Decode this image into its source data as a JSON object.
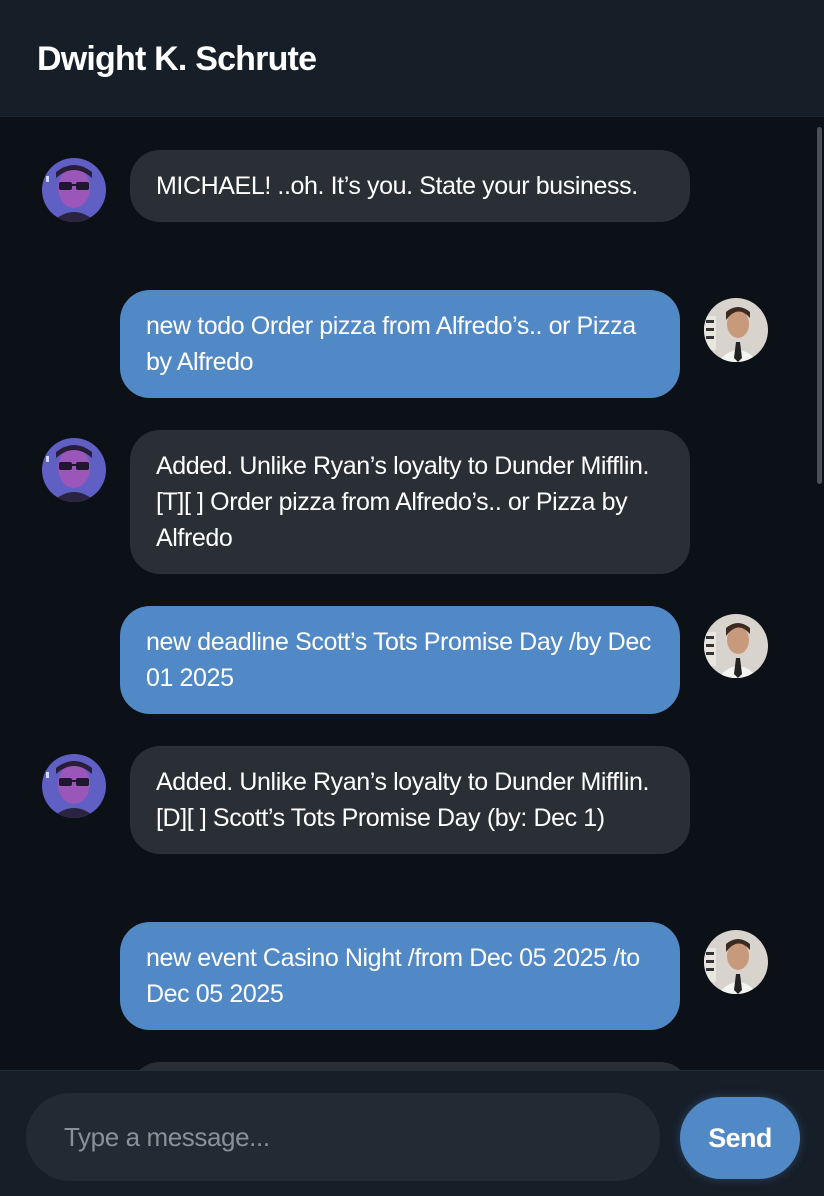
{
  "header": {
    "title": "Dwight K. Schrute"
  },
  "messages": [
    {
      "sender": "bot",
      "text": "MICHAEL! ..oh. It’s you. State your business."
    },
    {
      "sender": "user",
      "text": "new todo Order pizza from Alfredo’s.. or Pizza by Alfredo"
    },
    {
      "sender": "bot",
      "text": "Added. Unlike Ryan’s loyalty to Dunder Mifflin. [T][ ] Order pizza from Alfredo’s.. or Pizza by Alfredo"
    },
    {
      "sender": "user",
      "text": "new deadline Scott’s Tots Promise Day /by Dec 01 2025"
    },
    {
      "sender": "bot",
      "text": "Added. Unlike Ryan’s loyalty to Dunder Mifflin. [D][ ] Scott’s Tots Promise Day (by: Dec 1)"
    },
    {
      "sender": "user",
      "text": "new event Casino Night /from Dec 05 2025 /to Dec 05 2025"
    },
    {
      "sender": "bot",
      "text": ""
    }
  ],
  "composer": {
    "placeholder": "Type a message...",
    "value": "",
    "send_label": "Send"
  },
  "icons": {
    "bot_avatar": "dwight-avatar-icon",
    "user_avatar": "jim-avatar-icon"
  },
  "colors": {
    "background": "#0c1117",
    "header": "#161e28",
    "bot_bubble": "#2a2e35",
    "user_bubble": "#5189c6",
    "send_button": "#5189c6"
  }
}
